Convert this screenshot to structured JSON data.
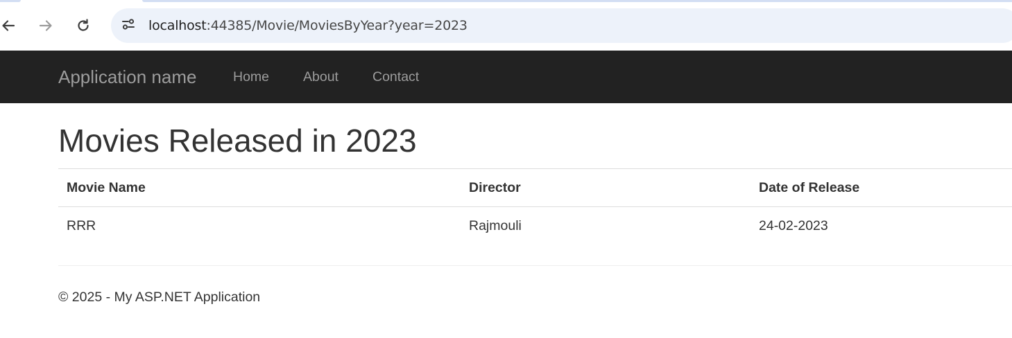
{
  "browser": {
    "url_host": "localhost",
    "url_rest": ":44385/Movie/MoviesByYear?year=2023",
    "icons": [
      "back-arrow-icon",
      "forward-arrow-icon",
      "reload-icon",
      "site-info-icon"
    ]
  },
  "navbar": {
    "brand": "Application name",
    "links": [
      {
        "label": "Home"
      },
      {
        "label": "About"
      },
      {
        "label": "Contact"
      }
    ],
    "background": "#222222",
    "link_color": "#9d9d9d"
  },
  "main": {
    "title": "Movies Released in 2023",
    "table": {
      "headers": [
        "Movie Name",
        "Director",
        "Date of Release"
      ],
      "rows": [
        [
          "RRR",
          "Rajmouli",
          "24-02-2023"
        ]
      ]
    }
  },
  "footer": {
    "text": "© 2025 - My ASP.NET Application"
  }
}
